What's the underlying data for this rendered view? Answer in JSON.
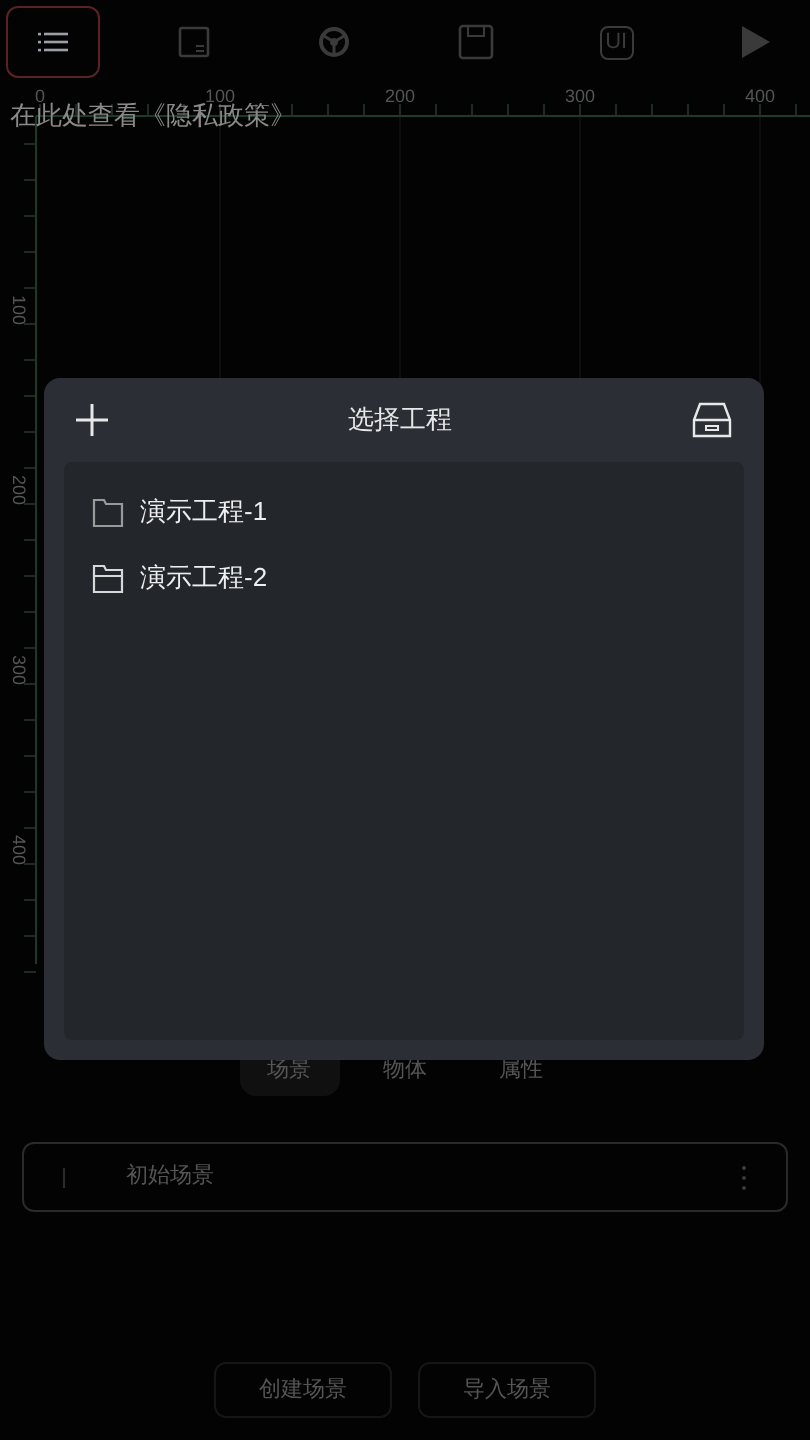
{
  "toolbar": [
    {
      "kind": "menu",
      "selected": true
    },
    {
      "kind": "panel",
      "selected": false
    },
    {
      "kind": "wheel",
      "selected": false
    },
    {
      "kind": "save",
      "selected": false
    },
    {
      "kind": "ui",
      "label": "UI",
      "selected": false
    },
    {
      "kind": "play",
      "selected": false
    }
  ],
  "ruler": {
    "top_labels": [
      "0",
      "100",
      "200",
      "300",
      "400"
    ],
    "left_labels": [
      "100",
      "200",
      "300",
      "400"
    ]
  },
  "privacy_link": "在此处查看《隐私政策》",
  "dialog": {
    "title": "选择工程",
    "items": [
      {
        "label": "演示工程-1",
        "kind": "folder"
      },
      {
        "label": "演示工程-2",
        "kind": "folder_open"
      }
    ]
  },
  "tabs": [
    {
      "label": "场景",
      "selected": true
    },
    {
      "label": "物体",
      "selected": false
    },
    {
      "label": "属性",
      "selected": false
    }
  ],
  "scenes": [
    {
      "label": "初始场景"
    }
  ],
  "buttons": [
    "创建场景",
    "导入场景"
  ]
}
